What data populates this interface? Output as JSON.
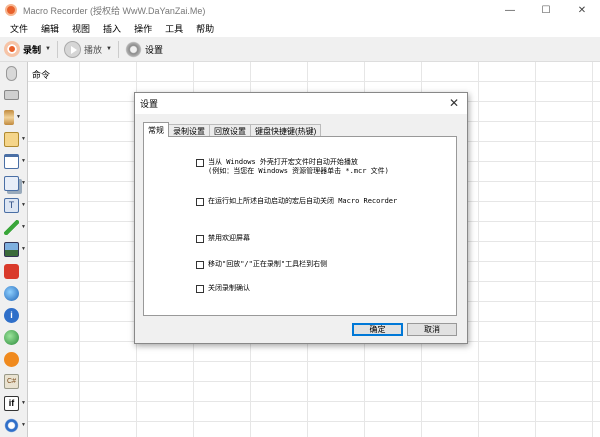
{
  "window": {
    "title": "Macro Recorder (授权给 WwW.DaYanZai.Me)"
  },
  "menu": [
    "文件",
    "编辑",
    "视图",
    "插入",
    "操作",
    "工具",
    "帮助"
  ],
  "toolbar": {
    "record": "录制",
    "play": "播放",
    "settings": "设置"
  },
  "grid": {
    "header": "命令"
  },
  "dialog": {
    "title": "设置",
    "tabs": [
      "常规",
      "录制设置",
      "回放设置",
      "键盘快捷键(热键)"
    ],
    "options": [
      {
        "line1": "当从 Windows 外壳打开宏文件时自动开始播放",
        "line2": "(例如：当您在 Windows 资源管理器单击 *.mcr 文件)"
      },
      {
        "line1": "在运行如上所述自动启动的宏后自动关闭 Macro Recorder",
        "line2": ""
      },
      {
        "line1": "禁用欢迎屏幕",
        "line2": ""
      },
      {
        "line1": "移动\"回放\"/\"正在录制\"工具栏到右侧",
        "line2": ""
      },
      {
        "line1": "关闭录制确认",
        "line2": ""
      }
    ],
    "ok": "确定",
    "cancel": "取消"
  },
  "colors": {
    "accent": "#e8612c",
    "dialog_bg": "#f0f0f0",
    "default_button_border": "#0078d7"
  },
  "icons": {
    "left_toolbar": [
      "mouse-icon",
      "keyboard-icon",
      "hourglass-icon",
      "window-icon",
      "window-resize-icon",
      "windows-stack-icon",
      "text-icon",
      "eyedropper-icon",
      "image-icon",
      "power-icon",
      "globe-icon",
      "info-icon",
      "globe-run-icon",
      "play-orange-icon",
      "csharp-icon",
      "if-icon",
      "loop-icon"
    ]
  }
}
